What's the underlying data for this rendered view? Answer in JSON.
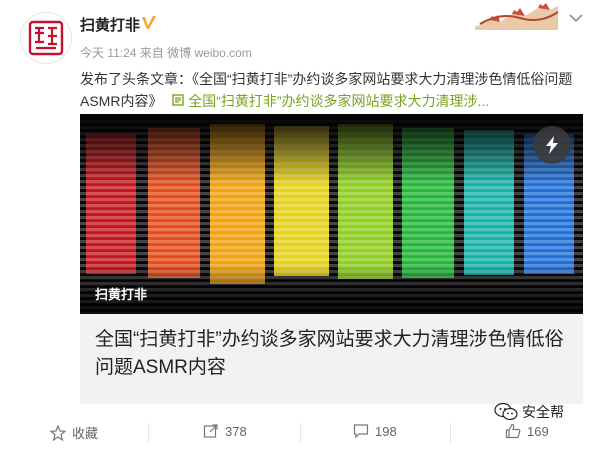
{
  "post": {
    "author": "扫黄打非",
    "meta": "今天 11:24 来自 微博 weibo.com",
    "text_prefix": "发布了头条文章：《全国“扫黄打非”办约谈多家网站要求大力清理涉色情低俗问题",
    "text_line2": "ASMR内容》",
    "link_text": "全国“扫黄打非”办约谈多家网站要求大力清理涉..."
  },
  "card": {
    "image_label": "扫黄打非",
    "title": "全国“扫黄打非”办约谈多家网站要求大力清理涉色情低俗问题ASMR内容"
  },
  "footer": {
    "favorite_label": "收藏",
    "repost_count": "378",
    "comment_count": "198",
    "like_count": "169"
  },
  "watermark": {
    "text": "安全帮"
  },
  "colors": {
    "link": "#7aa31e",
    "verified": "#f5a623",
    "seal_red": "#c8102e"
  }
}
